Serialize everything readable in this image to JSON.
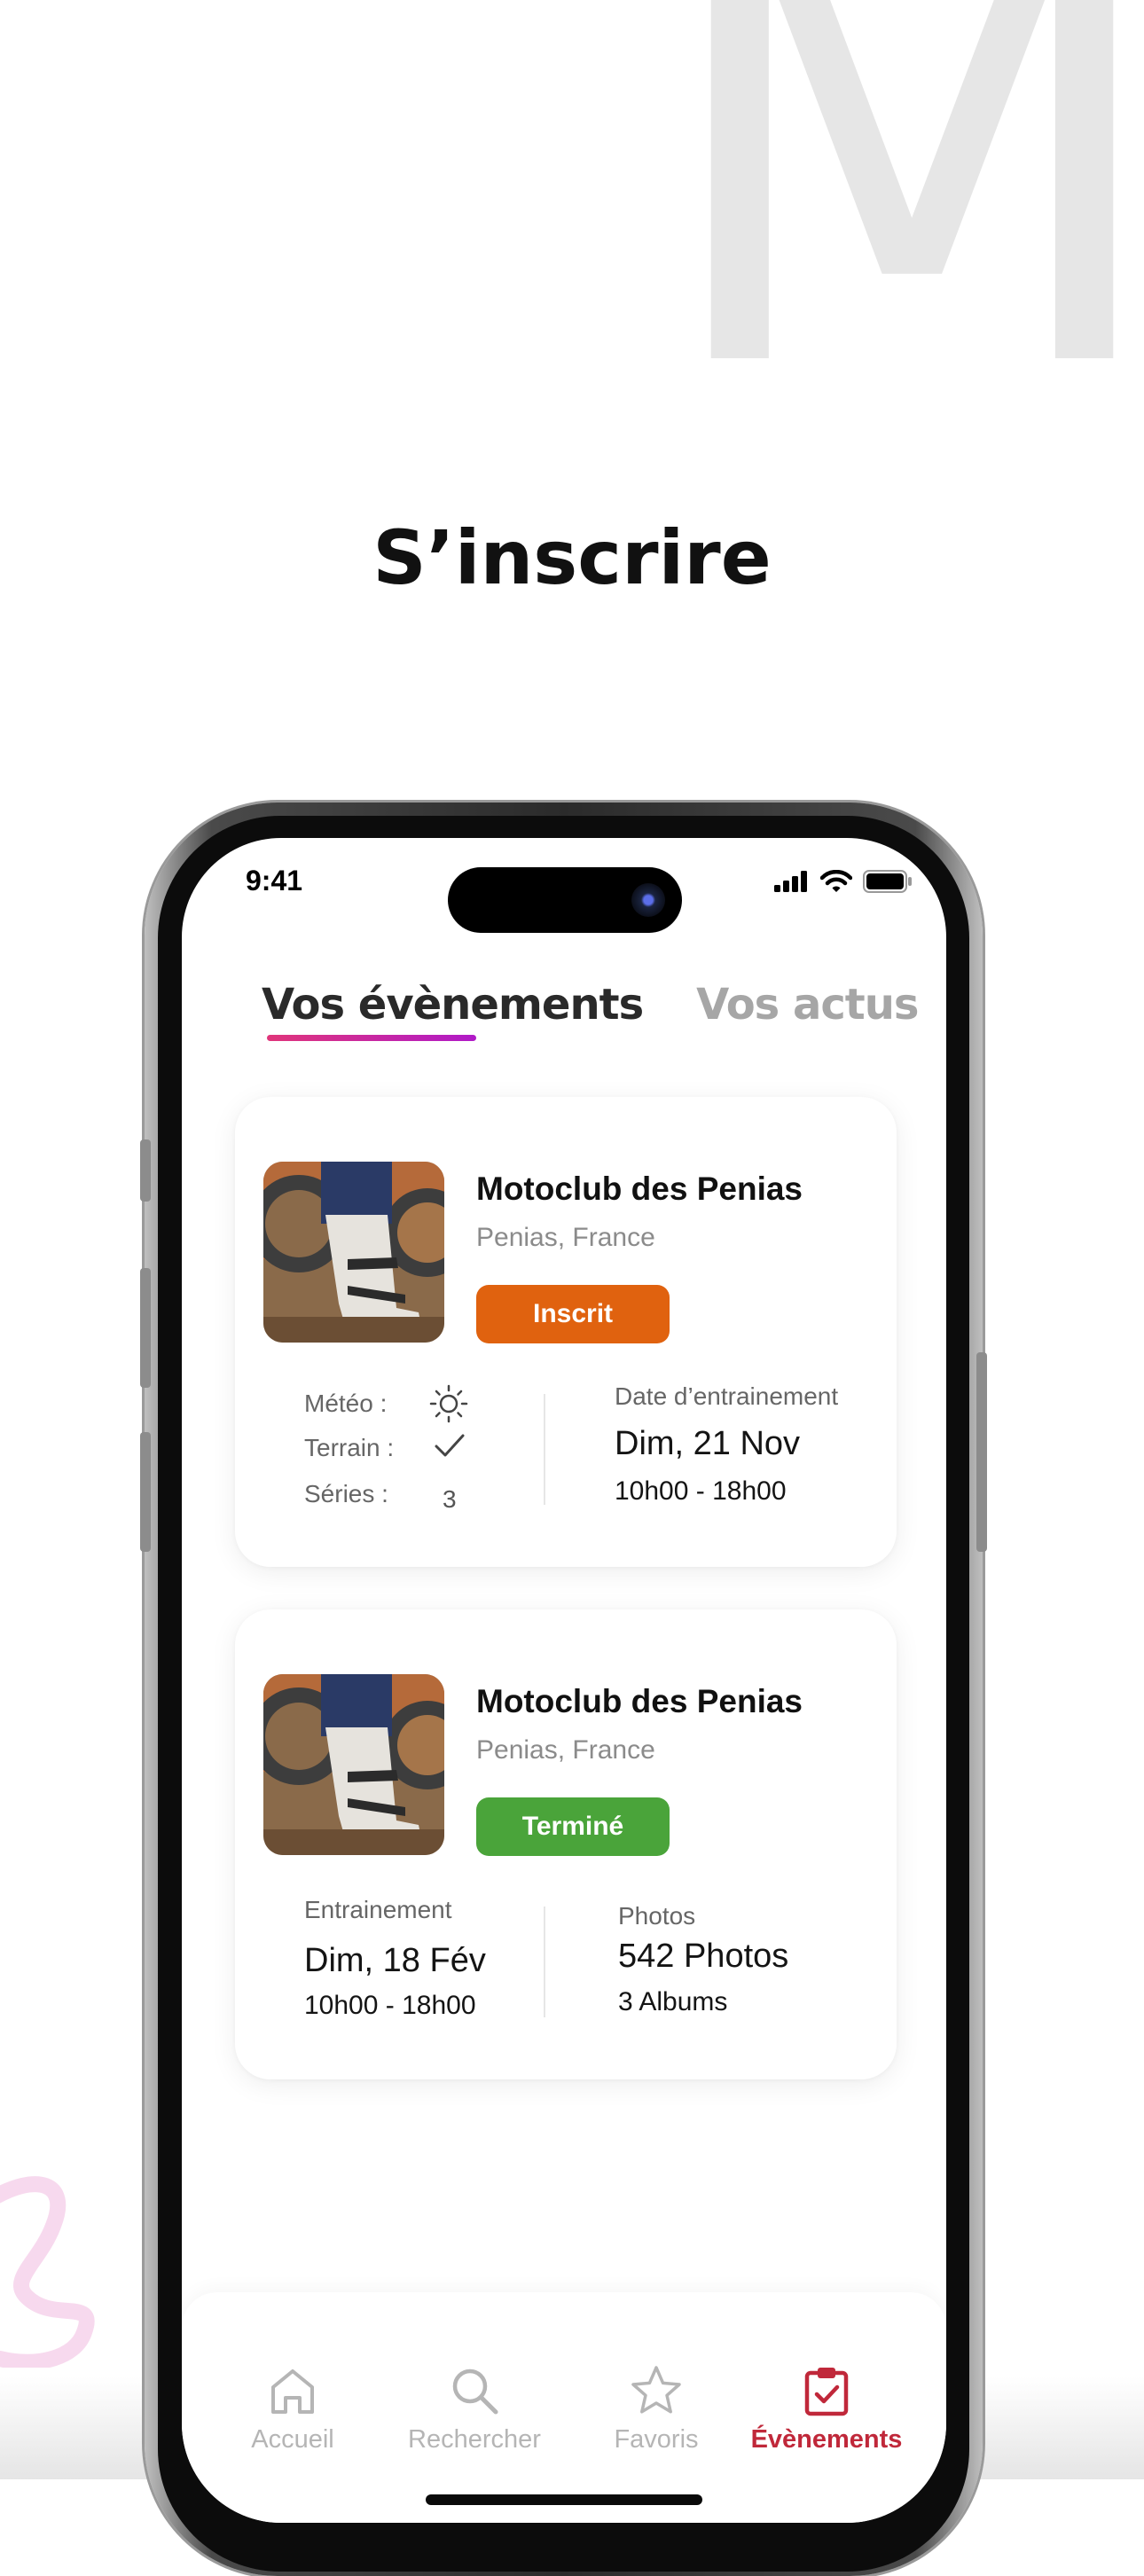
{
  "background": {
    "watermark_letter": "M",
    "title": "S’inscrire"
  },
  "status_bar": {
    "time": "9:41"
  },
  "tabs": [
    {
      "label": "Vos évènements",
      "active": true
    },
    {
      "label": "Vos actus",
      "active": false
    }
  ],
  "events": [
    {
      "title": "Motoclub des Penias",
      "location": "Penias, France",
      "status": "Inscrit",
      "status_color": "#e0620f",
      "left": {
        "meteo_label": "Météo :",
        "meteo_icon": "sun-icon",
        "terrain_label": "Terrain :",
        "terrain_icon": "check-icon",
        "series_label": "Séries :",
        "series_value": "3"
      },
      "right": {
        "label": "Date d’entrainement",
        "date": "Dim, 21 Nov",
        "hours": "10h00 - 18h00"
      }
    },
    {
      "title": "Motoclub des Penias",
      "location": "Penias, France",
      "status": "Terminé",
      "status_color": "#4aa43a",
      "left": {
        "label": "Entrainement",
        "date": "Dim, 18 Fév",
        "hours": "10h00 - 18h00"
      },
      "right": {
        "label": "Photos",
        "count": "542 Photos",
        "albums": "3 Albums"
      }
    }
  ],
  "nav": [
    {
      "label": "Accueil",
      "icon": "home-icon",
      "active": false
    },
    {
      "label": "Rechercher",
      "icon": "search-icon",
      "active": false
    },
    {
      "label": "Favoris",
      "icon": "star-icon",
      "active": false
    },
    {
      "label": "Évènements",
      "icon": "calendar-check-icon",
      "active": true
    }
  ],
  "colors": {
    "accent": "#c0283a",
    "inactive": "#b5b5b5",
    "tab_underline": [
      "#e0357a",
      "#b01ac8"
    ]
  }
}
